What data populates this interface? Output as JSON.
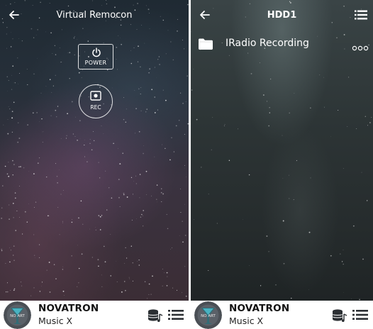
{
  "left_screen": {
    "title": "Virtual Remocon",
    "power_button_label": "POWER",
    "rec_button_label": "REC"
  },
  "right_screen": {
    "title": "HDD1",
    "folders": [
      {
        "label": "IRadio Recording"
      }
    ]
  },
  "player": {
    "title": "NOVATRON",
    "subtitle": "Music X",
    "album_art_text": "NO ART"
  },
  "icons": {
    "back": "back-arrow-icon",
    "menu": "menu-list-icon",
    "power": "power-icon",
    "record": "record-icon",
    "folder": "folder-icon",
    "more": "more-options-icon",
    "database": "database-music-icon",
    "playlist": "playlist-icon"
  },
  "colors": {
    "topbar_text": "#ffffff",
    "player_background": "#ffffff",
    "player_text": "#111111",
    "icon_dark": "#2b2f33"
  }
}
